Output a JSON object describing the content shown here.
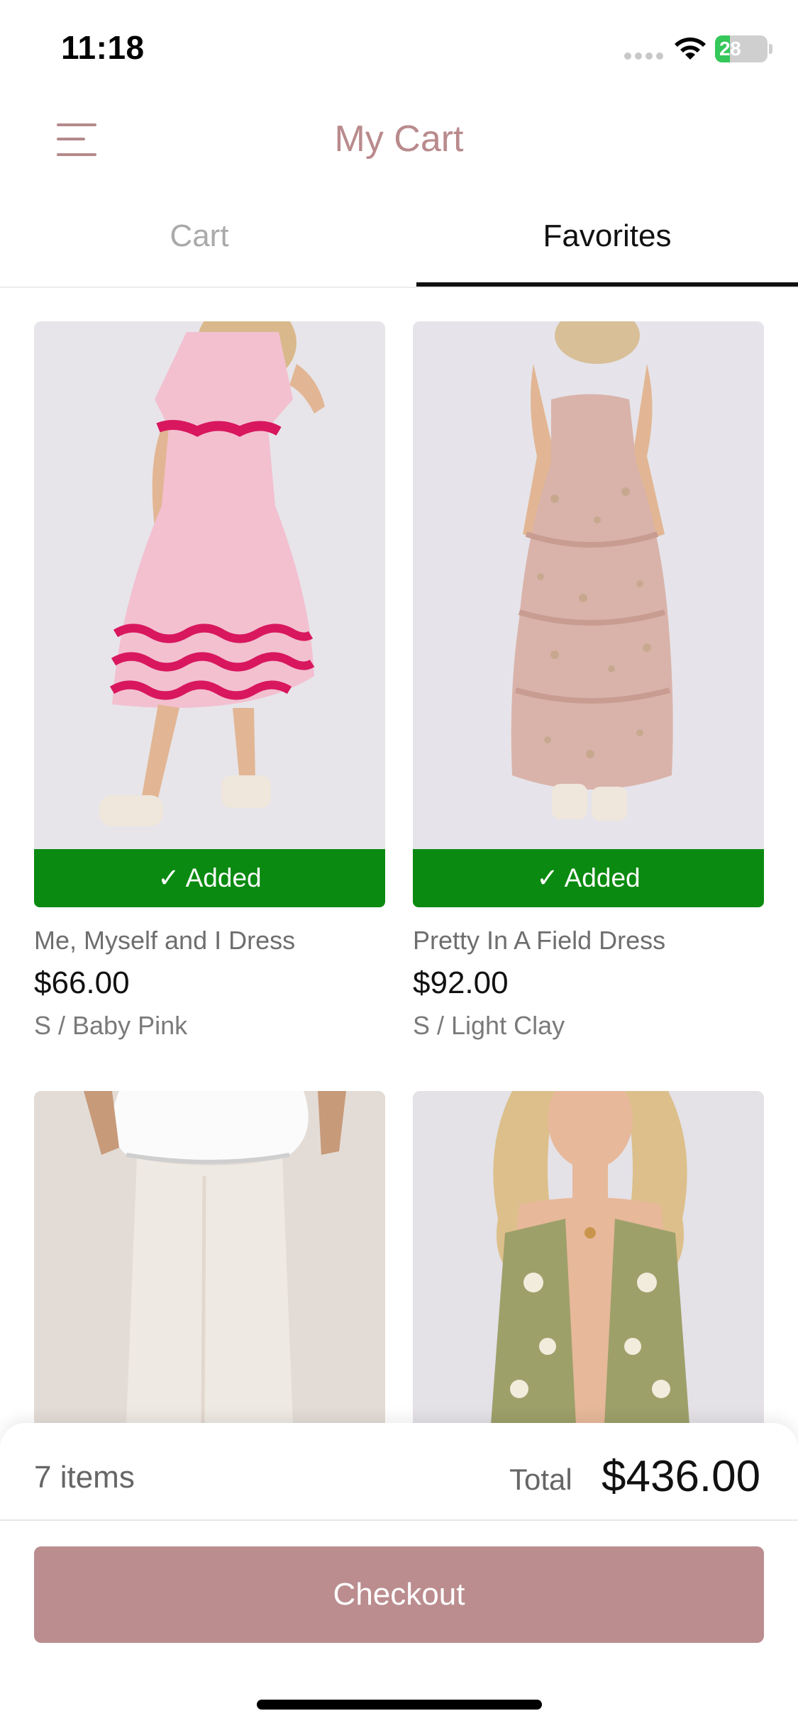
{
  "status_bar": {
    "time": "11:18",
    "battery": "28",
    "battery_level": 0.28,
    "icons": [
      "signal-icon",
      "wifi-icon",
      "battery-icon"
    ]
  },
  "header": {
    "title": "My Cart",
    "menu_icon": "menu-icon"
  },
  "tabs": [
    {
      "label": "Cart",
      "active": false
    },
    {
      "label": "Favorites",
      "active": true
    }
  ],
  "products": [
    {
      "name": "Me, Myself and I Dress",
      "price": "$66.00",
      "variant": "S / Baby Pink",
      "badge": "✓ Added"
    },
    {
      "name": "Pretty In A Field Dress",
      "price": "$92.00",
      "variant": "S / Light Clay",
      "badge": "✓ Added"
    },
    {
      "name": "",
      "price": "",
      "variant": ""
    },
    {
      "name": "",
      "price": "",
      "variant": ""
    }
  ],
  "summary": {
    "items_count": "7 items",
    "total_label": "Total",
    "total_value": "$436.00",
    "checkout_label": "Checkout"
  },
  "colors": {
    "accent": "#bb8d8f",
    "added_green": "#0a8a10",
    "title_pink": "#b98a8c",
    "battery_green": "#34c759"
  }
}
